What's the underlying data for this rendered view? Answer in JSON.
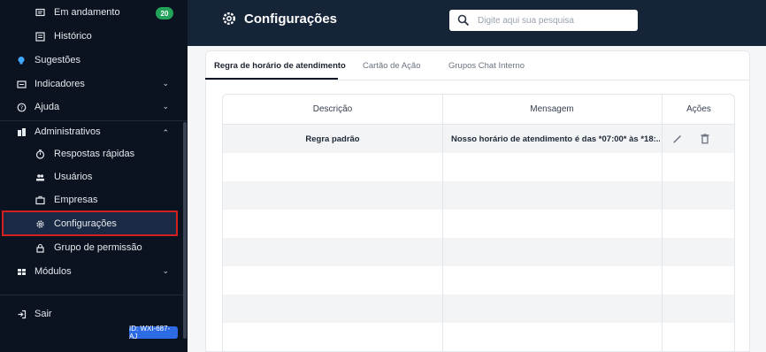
{
  "sidebar": {
    "items": [
      {
        "label": "Em andamento",
        "badge": "20",
        "icon": "chat-icon"
      },
      {
        "label": "Histórico",
        "icon": "history-icon"
      },
      {
        "label": "Sugestões",
        "icon": "lightbulb-icon"
      },
      {
        "label": "Indicadores",
        "icon": "chart-icon"
      },
      {
        "label": "Ajuda",
        "icon": "help-icon"
      },
      {
        "label": "Administrativos",
        "icon": "admin-icon"
      },
      {
        "label": "Respostas rápidas",
        "icon": "clock-icon"
      },
      {
        "label": "Usuários",
        "icon": "users-icon"
      },
      {
        "label": "Empresas",
        "icon": "briefcase-icon"
      },
      {
        "label": "Configurações",
        "icon": "gear-icon"
      },
      {
        "label": "Grupo de permissão",
        "icon": "lock-icon"
      },
      {
        "label": "Módulos",
        "icon": "grid-icon"
      },
      {
        "label": "Sair",
        "icon": "logout-icon"
      }
    ],
    "id_badge": "ID: WXI-687-AJ"
  },
  "header": {
    "title": "Configurações",
    "search_placeholder": "Digite aqui sua pesquisa"
  },
  "tabs": [
    {
      "label": "Regra de horário de atendimento",
      "active": true
    },
    {
      "label": "Cartão de Ação",
      "active": false
    },
    {
      "label": "Grupos Chat Interno",
      "active": false
    }
  ],
  "table": {
    "columns": [
      "Descrição",
      "Mensagem",
      "Ações"
    ],
    "rows": [
      {
        "descricao": "Regra padrão",
        "mensagem": "Nosso horário de atendimento é das *07:00* às *18:..."
      }
    ]
  },
  "colors": {
    "sidebar_bg": "#0b1220",
    "header_bg": "#162438",
    "badge_green": "#22a35a",
    "active_outline": "#d21f1f",
    "id_badge": "#2d6be4"
  }
}
